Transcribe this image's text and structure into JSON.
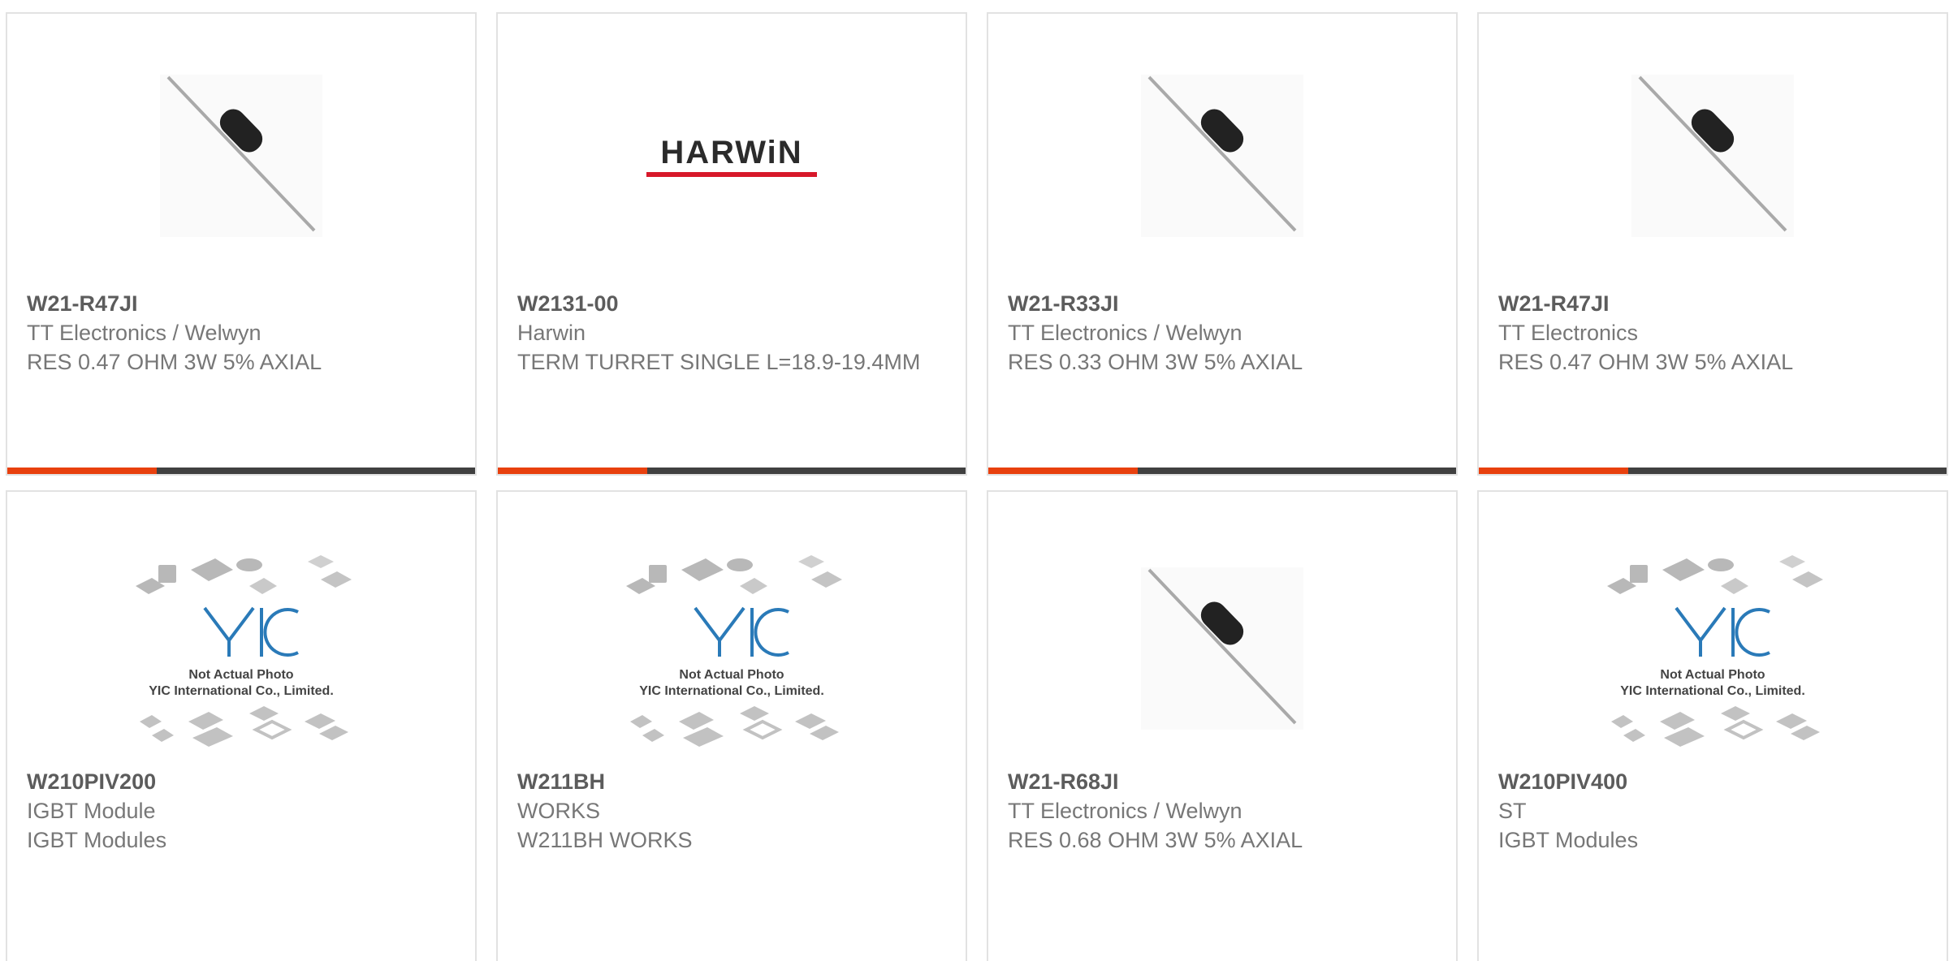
{
  "products": [
    {
      "part": "W21-R47JI",
      "manufacturer": "TT Electronics / Welwyn",
      "description": "RES 0.47 OHM 3W 5% AXIAL",
      "image": "resistor-image"
    },
    {
      "part": "W2131-00",
      "manufacturer": "Harwin",
      "description": "TERM TURRET SINGLE L=18.9-19.4MM",
      "image": "harwin-logo",
      "logo_text": "HARWiN"
    },
    {
      "part": "W21-R33JI",
      "manufacturer": "TT Electronics / Welwyn",
      "description": "RES 0.33 OHM 3W 5% AXIAL",
      "image": "resistor-image"
    },
    {
      "part": "W21-R47JI",
      "manufacturer": "TT Electronics",
      "description": "RES 0.47 OHM 3W 5% AXIAL",
      "image": "resistor-image"
    },
    {
      "part": "W210PIV200",
      "manufacturer": "IGBT Module",
      "description": "IGBT Modules",
      "image": "placeholder-image",
      "placeholder_line1": "Not Actual Photo",
      "placeholder_line2": "YIC International Co., Limited."
    },
    {
      "part": "W211BH",
      "manufacturer": "WORKS",
      "description": "W211BH WORKS",
      "image": "placeholder-image",
      "placeholder_line1": "Not Actual Photo",
      "placeholder_line2": "YIC International Co., Limited."
    },
    {
      "part": "W21-R68JI",
      "manufacturer": "TT Electronics / Welwyn",
      "description": "RES 0.68 OHM 3W 5% AXIAL",
      "image": "resistor-image"
    },
    {
      "part": "W210PIV400",
      "manufacturer": "ST",
      "description": "IGBT Modules",
      "image": "placeholder-image",
      "placeholder_line1": "Not Actual Photo",
      "placeholder_line2": "YIC International Co., Limited."
    }
  ],
  "colors": {
    "accent": "#e8400e",
    "bar": "#404040",
    "part_text": "#5c5c5c",
    "body_text": "#777777",
    "border": "#e2e2e2"
  }
}
